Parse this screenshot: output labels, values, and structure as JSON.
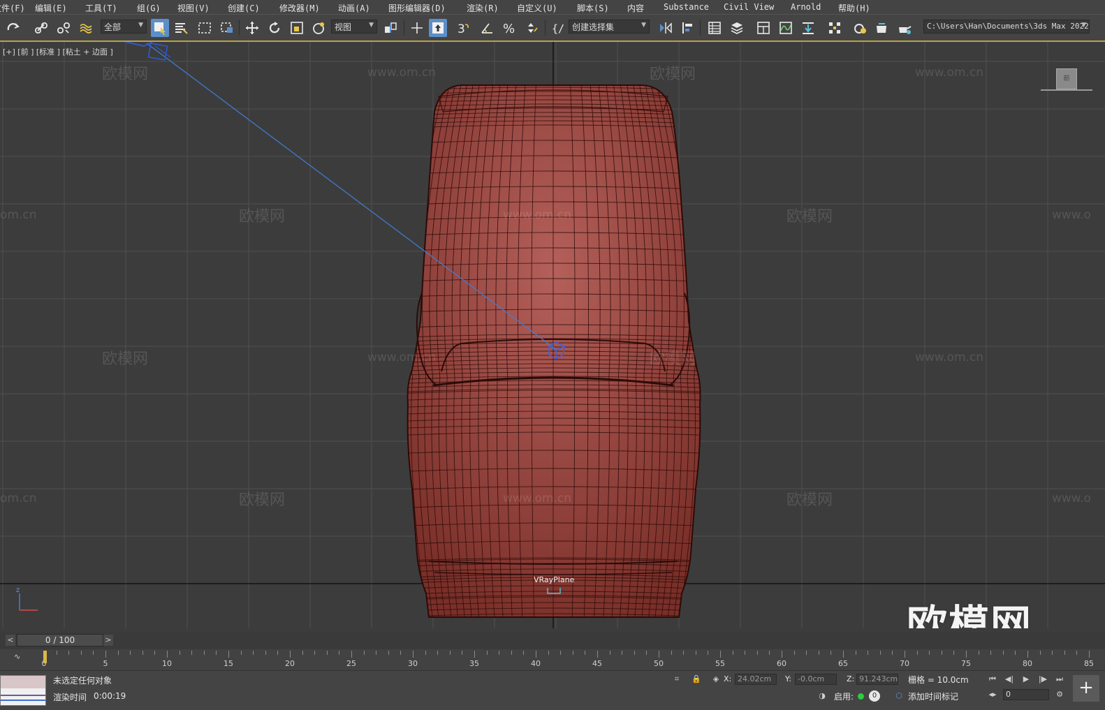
{
  "menu": [
    "文件(F)",
    "编辑(E)",
    "工具(T)",
    "组(G)",
    "视图(V)",
    "创建(C)",
    "修改器(M)",
    "动画(A)",
    "图形编辑器(D)",
    "渲染(R)",
    "自定义(U)",
    "脚本(S)",
    "内容",
    "Substance",
    "Civil View",
    "Arnold",
    "帮助(H)"
  ],
  "toolbar": {
    "selection_filter": "全部",
    "ref_coord": "视图",
    "named_selection": "创建选择集",
    "path": "C:\\Users\\Han\\Documents\\3ds Max 2022"
  },
  "viewport": {
    "label": "[+] [前 ] [标准 ] [粘土 + 边面 ]",
    "object_label": "VRayPlane",
    "viewcube_label": "前",
    "watermark_cn": "欧模网",
    "watermark_url": "www.om.cn",
    "watermark_url_cut": "om.cn",
    "watermark_url_cut2": "www.o",
    "logo": "欧模网",
    "axis_z": "z",
    "colors": {
      "model": "#8e3b33",
      "wire": "#2c0b08",
      "grid": "#4f4f4f",
      "axis": "#0a0a0a",
      "light": "#3f7fd9"
    }
  },
  "timeslider": {
    "frame": "0 / 100",
    "prev": "<",
    "next": ">"
  },
  "trackbar": {
    "ticks": [
      "0",
      "5",
      "10",
      "15",
      "20",
      "25",
      "30",
      "35",
      "40",
      "45",
      "50",
      "55",
      "60",
      "65",
      "70",
      "75",
      "80",
      "85"
    ]
  },
  "status": {
    "selection": "未选定任何对象",
    "render_time_label": "渲染时间",
    "render_time": "0:00:19",
    "x_label": "X:",
    "x": "24.02cm",
    "y_label": "Y:",
    "y": "-0.0cm",
    "z_label": "Z:",
    "z": "91.243cm",
    "grid": "栅格 = 10.0cm",
    "enable": "启用:",
    "enable_count": "0",
    "add_time_tag": "添加时间标记",
    "frame_value": "0",
    "add_key": "+"
  }
}
